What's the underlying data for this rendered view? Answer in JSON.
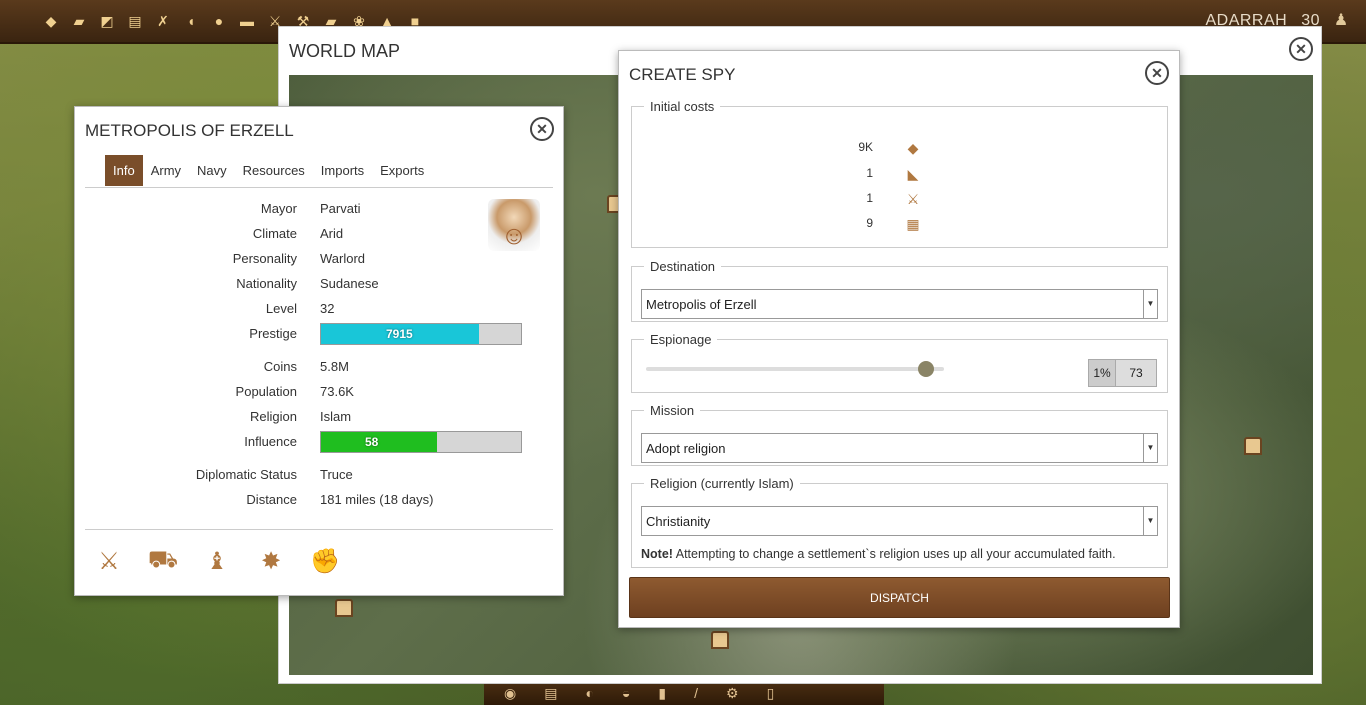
{
  "topbar": {
    "player_name": "ADARRAH",
    "player_level": "30",
    "resource_icons": [
      "gold-icon",
      "wood-icon",
      "iron-icon",
      "clay-icon",
      "tools-icon",
      "bread-icon",
      "meat-icon",
      "cloth-icon",
      "weapons-icon",
      "hammer-icon",
      "stone-icon",
      "fire-icon",
      "gem-icon",
      "crate-icon"
    ]
  },
  "worldmap": {
    "title": "WORLD MAP"
  },
  "metropolis": {
    "title": "METROPOLIS OF ERZELL",
    "tabs": [
      "Info",
      "Army",
      "Navy",
      "Resources",
      "Imports",
      "Exports"
    ],
    "active_tab": "Info",
    "mayor_label": "Mayor",
    "mayor": "Parvati",
    "climate_label": "Climate",
    "climate": "Arid",
    "personality_label": "Personality",
    "personality": "Warlord",
    "nationality_label": "Nationality",
    "nationality": "Sudanese",
    "level_label": "Level",
    "level": "32",
    "prestige_label": "Prestige",
    "prestige": "7915",
    "prestige_fraction": 0.79,
    "coins_label": "Coins",
    "coins": "5.8M",
    "population_label": "Population",
    "population": "73.6K",
    "religion_label": "Religion",
    "religion": "Islam",
    "influence_label": "Influence",
    "influence": "58",
    "influence_fraction": 0.58,
    "diplomatic_label": "Diplomatic Status",
    "diplomatic": "Truce",
    "distance_label": "Distance",
    "distance": "181 miles (18 days)",
    "colors": {
      "prestige_bar": "#19c6d8",
      "influence_bar": "#1fbe1f",
      "active_tab": "#7a4e2a"
    }
  },
  "spy": {
    "title": "CREATE SPY",
    "initial_costs_legend": "Initial costs",
    "costs": [
      {
        "value": "9K",
        "icon": "coins-icon"
      },
      {
        "value": "1",
        "icon": "horn-icon"
      },
      {
        "value": "1",
        "icon": "swords-icon"
      },
      {
        "value": "9",
        "icon": "chest-icon"
      }
    ],
    "destination_legend": "Destination",
    "destination_value": "Metropolis of Erzell",
    "espionage_legend": "Espionage",
    "espionage_fraction": 0.94,
    "espionage_percent_label": "1%",
    "espionage_value": "73",
    "mission_legend": "Mission",
    "mission_value": "Adopt religion",
    "religion_legend": "Religion (currently Islam)",
    "religion_value": "Christianity",
    "note_bold": "Note!",
    "note_text": " Attempting to change a settlement`s religion uses up all your accumulated faith.",
    "dispatch_label": "DISPATCH"
  }
}
